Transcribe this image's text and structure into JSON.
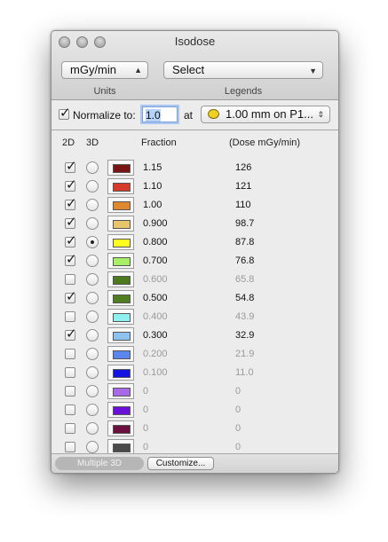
{
  "window": {
    "title": "Isodose"
  },
  "units": {
    "value": "mGy/min",
    "caption": "Units"
  },
  "legends": {
    "value": "Select",
    "caption": "Legends"
  },
  "normalize": {
    "label": "Normalize to:",
    "checked": true,
    "value": "1.0",
    "at_label": "at",
    "location": "1.00 mm on P1..."
  },
  "columns": {
    "d2": "2D",
    "d3": "3D",
    "fraction": "Fraction",
    "dose": "(Dose mGy/min)"
  },
  "rows": [
    {
      "check2d": true,
      "radio3d": false,
      "color": "#7a1414",
      "fraction": "1.15",
      "dose": "126",
      "enabled": true
    },
    {
      "check2d": true,
      "radio3d": false,
      "color": "#d63a2a",
      "fraction": "1.10",
      "dose": "121",
      "enabled": true
    },
    {
      "check2d": true,
      "radio3d": false,
      "color": "#e08830",
      "fraction": "1.00",
      "dose": "110",
      "enabled": true
    },
    {
      "check2d": true,
      "radio3d": false,
      "color": "#e8c46c",
      "fraction": "0.900",
      "dose": "98.7",
      "enabled": true
    },
    {
      "check2d": true,
      "radio3d": true,
      "color": "#ffff22",
      "fraction": "0.800",
      "dose": "87.8",
      "enabled": true
    },
    {
      "check2d": true,
      "radio3d": false,
      "color": "#a6ef66",
      "fraction": "0.700",
      "dose": "76.8",
      "enabled": true
    },
    {
      "check2d": false,
      "radio3d": false,
      "color": "#4c7a1c",
      "fraction": "0.600",
      "dose": "65.8",
      "enabled": false
    },
    {
      "check2d": true,
      "radio3d": false,
      "color": "#4f7d1f",
      "fraction": "0.500",
      "dose": "54.8",
      "enabled": true
    },
    {
      "check2d": false,
      "radio3d": false,
      "color": "#8ff0f0",
      "fraction": "0.400",
      "dose": "43.9",
      "enabled": false
    },
    {
      "check2d": true,
      "radio3d": false,
      "color": "#8cc1f0",
      "fraction": "0.300",
      "dose": "32.9",
      "enabled": true
    },
    {
      "check2d": false,
      "radio3d": false,
      "color": "#5a86ee",
      "fraction": "0.200",
      "dose": "21.9",
      "enabled": false
    },
    {
      "check2d": false,
      "radio3d": false,
      "color": "#1414e0",
      "fraction": "0.100",
      "dose": "11.0",
      "enabled": false
    },
    {
      "check2d": false,
      "radio3d": false,
      "color": "#a86ae8",
      "fraction": "0",
      "dose": "0",
      "enabled": false
    },
    {
      "check2d": false,
      "radio3d": false,
      "color": "#6a10d8",
      "fraction": "0",
      "dose": "0",
      "enabled": false
    },
    {
      "check2d": false,
      "radio3d": false,
      "color": "#6c1040",
      "fraction": "0",
      "dose": "0",
      "enabled": false
    },
    {
      "check2d": false,
      "radio3d": false,
      "color": "#4a4a4a",
      "fraction": "0",
      "dose": "0",
      "enabled": false
    }
  ],
  "footer": {
    "multiple3d": "Multiple 3D",
    "customize": "Customize..."
  },
  "icons": {
    "location_popup": "ruler-dish-icon",
    "checkmark": "checkmark-icon"
  }
}
